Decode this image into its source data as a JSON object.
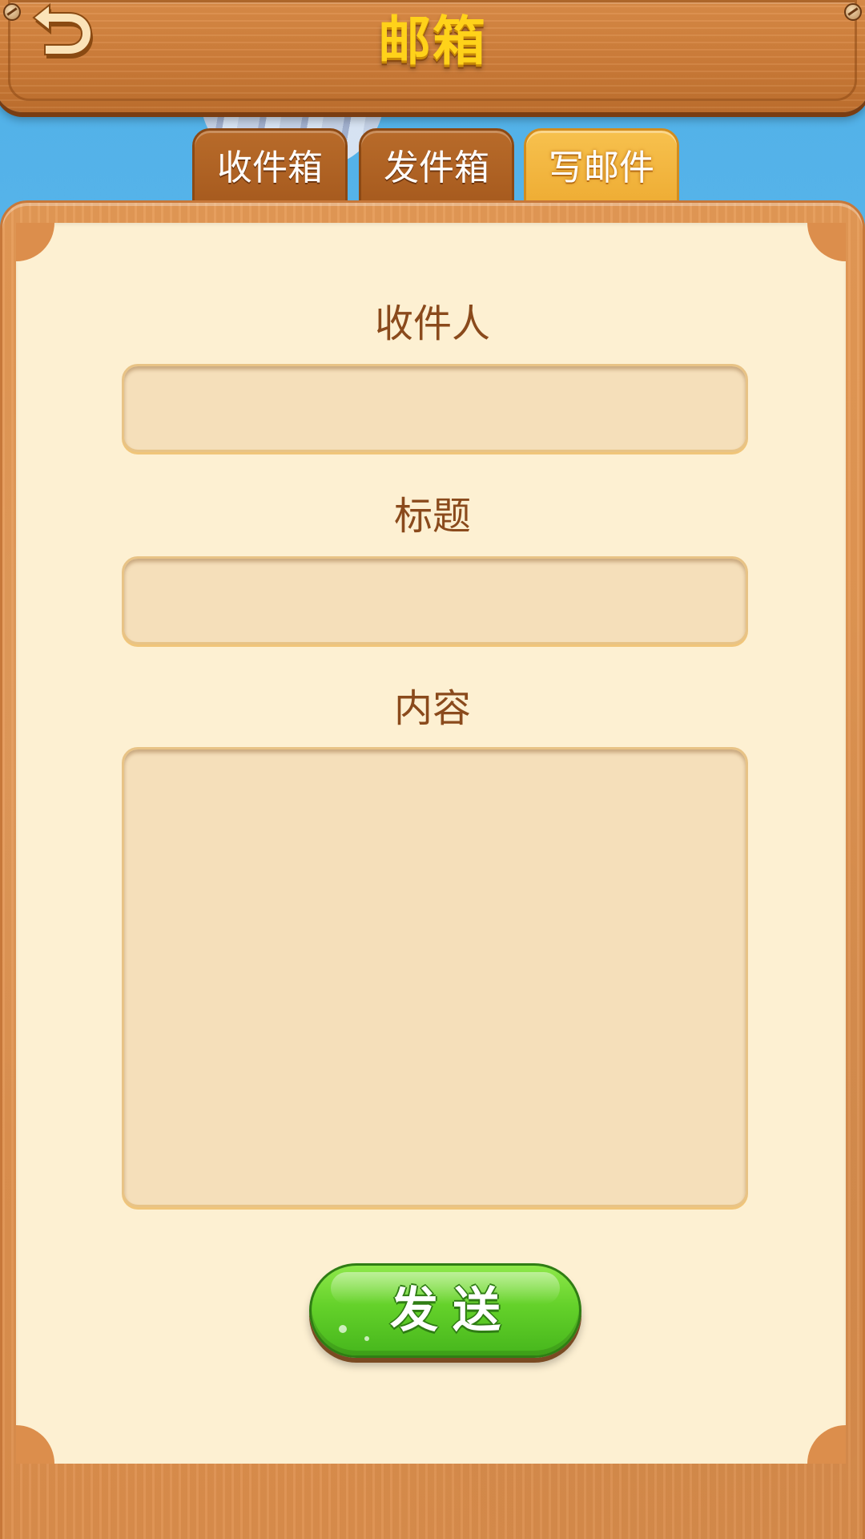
{
  "header": {
    "title": "邮箱"
  },
  "tabs": [
    {
      "label": "收件箱",
      "active": false
    },
    {
      "label": "发件箱",
      "active": false
    },
    {
      "label": "写邮件",
      "active": true
    }
  ],
  "form": {
    "recipient_label": "收件人",
    "recipient_value": "",
    "title_label": "标题",
    "title_value": "",
    "content_label": "内容",
    "content_value": ""
  },
  "send_button": {
    "label": "发送"
  },
  "colors": {
    "title_gold": "#ffd21a",
    "wood": "#dc8e4c",
    "paper": "#fdf0d2",
    "field_bg": "#f5dfba",
    "label_brown": "#8a4a1c",
    "tab_active": "#f7c14e",
    "tab_inactive": "#b86b2a",
    "send_green": "#64d12a"
  },
  "icons": {
    "back": "back-arrow-icon"
  }
}
